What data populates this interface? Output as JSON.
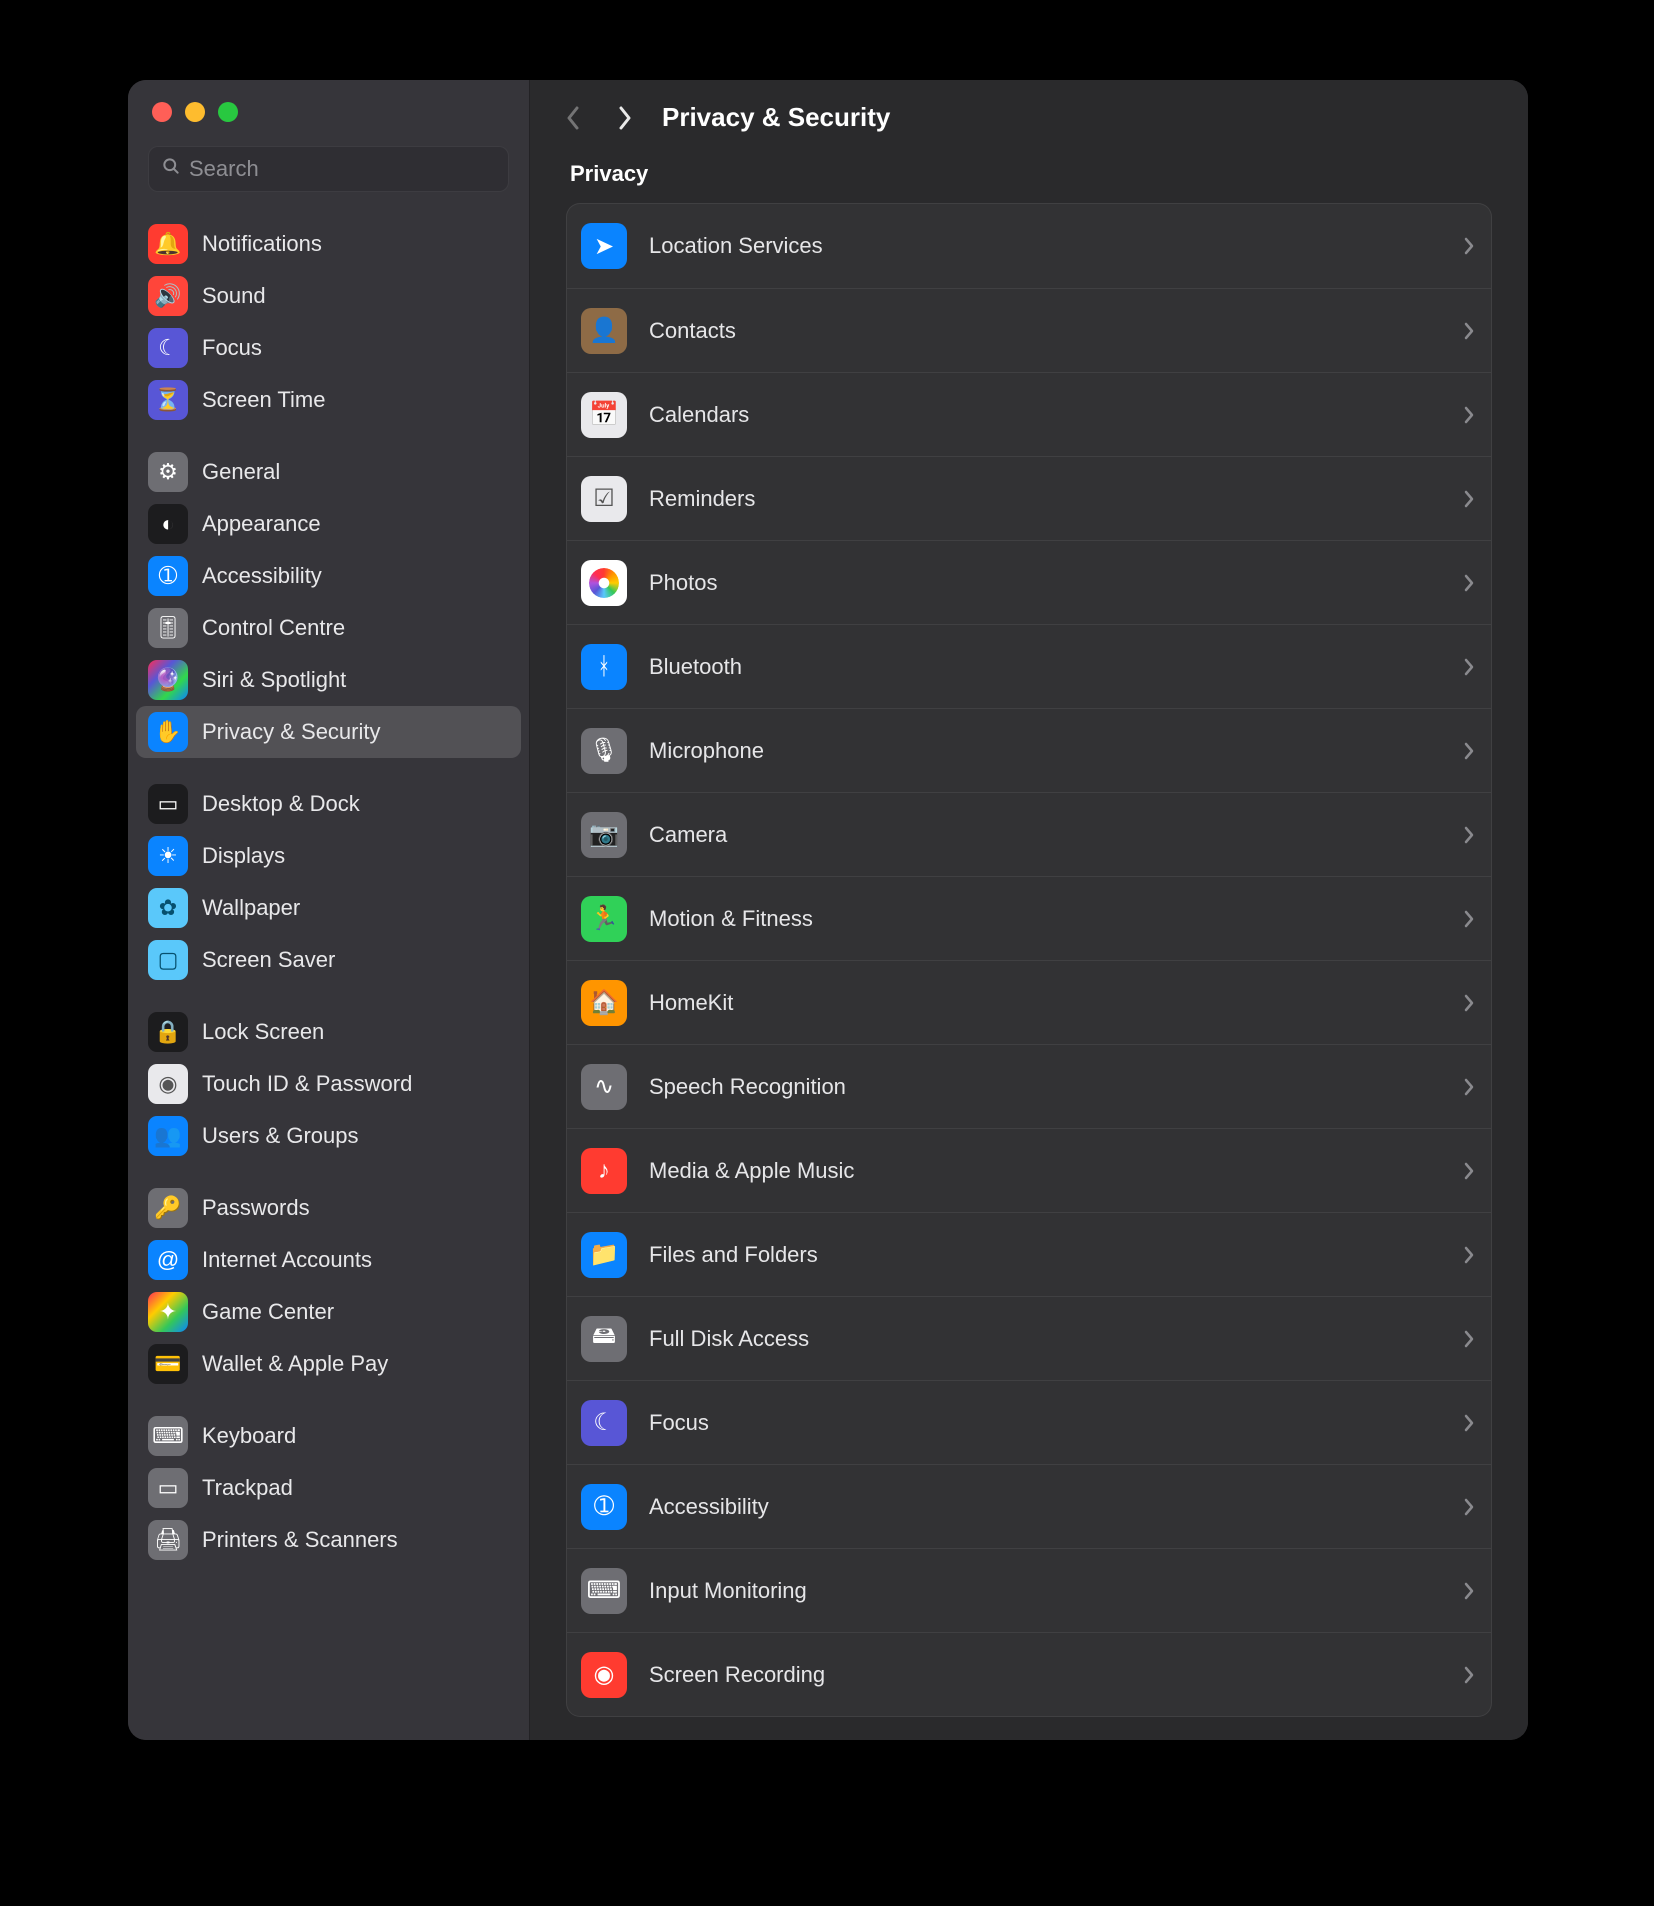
{
  "header": {
    "title": "Privacy & Security"
  },
  "search": {
    "placeholder": "Search",
    "value": ""
  },
  "section": {
    "privacy_title": "Privacy"
  },
  "sidebar": {
    "groups": [
      [
        {
          "id": "notifications",
          "label": "Notifications",
          "icon": "bell-badge-icon",
          "bg": "bg-red"
        },
        {
          "id": "sound",
          "label": "Sound",
          "icon": "speaker-icon",
          "bg": "bg-red2"
        },
        {
          "id": "focus",
          "label": "Focus",
          "icon": "moon-icon",
          "bg": "bg-indigo"
        },
        {
          "id": "screentime",
          "label": "Screen Time",
          "icon": "hourglass-icon",
          "bg": "bg-indigo"
        }
      ],
      [
        {
          "id": "general",
          "label": "General",
          "icon": "gear-icon",
          "bg": "bg-gray"
        },
        {
          "id": "appearance",
          "label": "Appearance",
          "icon": "contrast-icon",
          "bg": "bg-dark"
        },
        {
          "id": "accessibility",
          "label": "Accessibility",
          "icon": "accessibility-icon",
          "bg": "bg-blue"
        },
        {
          "id": "controlcenter",
          "label": "Control Centre",
          "icon": "switches-icon",
          "bg": "bg-gray"
        },
        {
          "id": "siri",
          "label": "Siri & Spotlight",
          "icon": "siri-icon",
          "bg": "bg-siri"
        },
        {
          "id": "privacy",
          "label": "Privacy & Security",
          "icon": "hand-icon",
          "bg": "bg-blue",
          "selected": true
        }
      ],
      [
        {
          "id": "desktop",
          "label": "Desktop & Dock",
          "icon": "dock-icon",
          "bg": "bg-dark"
        },
        {
          "id": "displays",
          "label": "Displays",
          "icon": "sun-icon",
          "bg": "bg-blue"
        },
        {
          "id": "wallpaper",
          "label": "Wallpaper",
          "icon": "flower-icon",
          "bg": "bg-cyan"
        },
        {
          "id": "screensaver",
          "label": "Screen Saver",
          "icon": "screensaver-icon",
          "bg": "bg-cyan"
        }
      ],
      [
        {
          "id": "lockscreen",
          "label": "Lock Screen",
          "icon": "lock-icon",
          "bg": "bg-dark"
        },
        {
          "id": "touchid",
          "label": "Touch ID & Password",
          "icon": "fingerprint-icon",
          "bg": "bg-white"
        },
        {
          "id": "users",
          "label": "Users & Groups",
          "icon": "users-icon",
          "bg": "bg-blue"
        }
      ],
      [
        {
          "id": "passwords",
          "label": "Passwords",
          "icon": "key-icon",
          "bg": "bg-gray"
        },
        {
          "id": "internet",
          "label": "Internet Accounts",
          "icon": "at-icon",
          "bg": "bg-blue"
        },
        {
          "id": "gamecenter",
          "label": "Game Center",
          "icon": "gamecenter-icon",
          "bg": "bg-multi"
        },
        {
          "id": "wallet",
          "label": "Wallet & Apple Pay",
          "icon": "wallet-icon",
          "bg": "bg-dark"
        }
      ],
      [
        {
          "id": "keyboard",
          "label": "Keyboard",
          "icon": "keyboard-icon",
          "bg": "bg-gray"
        },
        {
          "id": "trackpad",
          "label": "Trackpad",
          "icon": "trackpad-icon",
          "bg": "bg-gray"
        },
        {
          "id": "printers",
          "label": "Printers & Scanners",
          "icon": "printer-icon",
          "bg": "bg-gray"
        }
      ]
    ]
  },
  "rows": [
    {
      "id": "location",
      "label": "Location Services",
      "icon": "location-icon",
      "bg": "bg-blue"
    },
    {
      "id": "contacts",
      "label": "Contacts",
      "icon": "contacts-icon",
      "bg": "bg-brown"
    },
    {
      "id": "calendars",
      "label": "Calendars",
      "icon": "calendar-icon",
      "bg": "bg-white"
    },
    {
      "id": "reminders",
      "label": "Reminders",
      "icon": "reminders-icon",
      "bg": "bg-white"
    },
    {
      "id": "photos",
      "label": "Photos",
      "icon": "photos-icon",
      "bg": "bg-photos"
    },
    {
      "id": "bluetooth",
      "label": "Bluetooth",
      "icon": "bluetooth-icon",
      "bg": "bg-blue"
    },
    {
      "id": "microphone",
      "label": "Microphone",
      "icon": "mic-icon",
      "bg": "bg-gray"
    },
    {
      "id": "camera",
      "label": "Camera",
      "icon": "camera-icon",
      "bg": "bg-gray"
    },
    {
      "id": "motion",
      "label": "Motion & Fitness",
      "icon": "running-icon",
      "bg": "bg-green"
    },
    {
      "id": "homekit",
      "label": "HomeKit",
      "icon": "home-icon",
      "bg": "bg-orange"
    },
    {
      "id": "speech",
      "label": "Speech Recognition",
      "icon": "waveform-icon",
      "bg": "bg-gray"
    },
    {
      "id": "media",
      "label": "Media & Apple Music",
      "icon": "music-icon",
      "bg": "bg-red"
    },
    {
      "id": "files",
      "label": "Files and Folders",
      "icon": "folder-icon",
      "bg": "bg-blue"
    },
    {
      "id": "fulldisk",
      "label": "Full Disk Access",
      "icon": "disk-icon",
      "bg": "bg-gray"
    },
    {
      "id": "focus2",
      "label": "Focus",
      "icon": "moon-icon",
      "bg": "bg-indigo"
    },
    {
      "id": "access2",
      "label": "Accessibility",
      "icon": "accessibility-icon",
      "bg": "bg-blue"
    },
    {
      "id": "inputmon",
      "label": "Input Monitoring",
      "icon": "inputmon-icon",
      "bg": "bg-gray"
    },
    {
      "id": "screenrec",
      "label": "Screen Recording",
      "icon": "record-icon",
      "bg": "bg-red"
    }
  ],
  "glyphs": {
    "bell-badge-icon": "🔔",
    "speaker-icon": "🔊",
    "moon-icon": "☾",
    "hourglass-icon": "⏳",
    "gear-icon": "⚙",
    "contrast-icon": "◐",
    "accessibility-icon": "➀",
    "switches-icon": "🎚",
    "siri-icon": "🔮",
    "hand-icon": "✋",
    "dock-icon": "▭",
    "sun-icon": "☀",
    "flower-icon": "✿",
    "screensaver-icon": "▢",
    "lock-icon": "🔒",
    "fingerprint-icon": "◉",
    "users-icon": "👥",
    "key-icon": "🔑",
    "at-icon": "@",
    "gamecenter-icon": "✦",
    "wallet-icon": "💳",
    "keyboard-icon": "⌨",
    "trackpad-icon": "▭",
    "printer-icon": "🖨",
    "location-icon": "➤",
    "contacts-icon": "👤",
    "calendar-icon": "📅",
    "reminders-icon": "☑",
    "bluetooth-icon": "ᚼ",
    "mic-icon": "🎙",
    "camera-icon": "📷",
    "running-icon": "🏃",
    "home-icon": "🏠",
    "waveform-icon": "∿",
    "music-icon": "♪",
    "folder-icon": "📁",
    "disk-icon": "🖴",
    "inputmon-icon": "⌨",
    "record-icon": "◉",
    "photos-icon": ""
  }
}
